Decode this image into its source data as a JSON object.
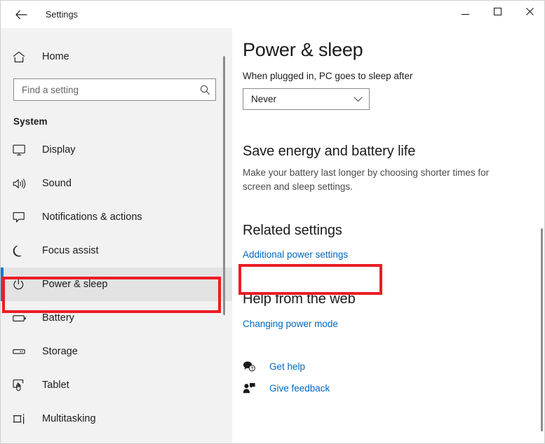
{
  "titlebar": {
    "back_icon": "back-arrow-icon",
    "title": "Settings",
    "minimize": "minimize-icon",
    "maximize": "maximize-icon",
    "close": "close-icon"
  },
  "sidebar": {
    "home": {
      "icon": "home-icon",
      "label": "Home"
    },
    "search": {
      "placeholder": "Find a setting",
      "value": "",
      "icon": "search-icon"
    },
    "group_heading": "System",
    "items": [
      {
        "icon": "display-icon",
        "label": "Display",
        "selected": false
      },
      {
        "icon": "sound-icon",
        "label": "Sound",
        "selected": false
      },
      {
        "icon": "notifications-icon",
        "label": "Notifications & actions",
        "selected": false
      },
      {
        "icon": "moon-icon",
        "label": "Focus assist",
        "selected": false
      },
      {
        "icon": "power-icon",
        "label": "Power & sleep",
        "selected": true
      },
      {
        "icon": "battery-icon",
        "label": "Battery",
        "selected": false
      },
      {
        "icon": "storage-icon",
        "label": "Storage",
        "selected": false
      },
      {
        "icon": "tablet-icon",
        "label": "Tablet",
        "selected": false
      },
      {
        "icon": "multitasking-icon",
        "label": "Multitasking",
        "selected": false
      }
    ]
  },
  "main": {
    "page_title": "Power & sleep",
    "sleep_label": "When plugged in, PC goes to sleep after",
    "sleep_value": "Never",
    "sleep_chevron": "chevron-down-icon",
    "save_energy": {
      "heading": "Save energy and battery life",
      "body": "Make your battery last longer by choosing shorter times for screen and sleep settings."
    },
    "related_settings": {
      "heading": "Related settings",
      "link": "Additional power settings"
    },
    "help_from_web": {
      "heading": "Help from the web",
      "link": "Changing power mode"
    },
    "support_links": [
      {
        "icon": "get-help-icon",
        "label": "Get help"
      },
      {
        "icon": "give-feedback-icon",
        "label": "Give feedback"
      }
    ]
  },
  "annotations": {
    "highlight_color": "#ec1c24",
    "boxes": [
      {
        "target": "Power & sleep"
      },
      {
        "target": "Additional power settings"
      }
    ]
  },
  "colors": {
    "accent": "#0078d4",
    "link": "#0067c0",
    "sidebar_bg": "#f2f2f2",
    "content_bg": "#ffffff"
  }
}
